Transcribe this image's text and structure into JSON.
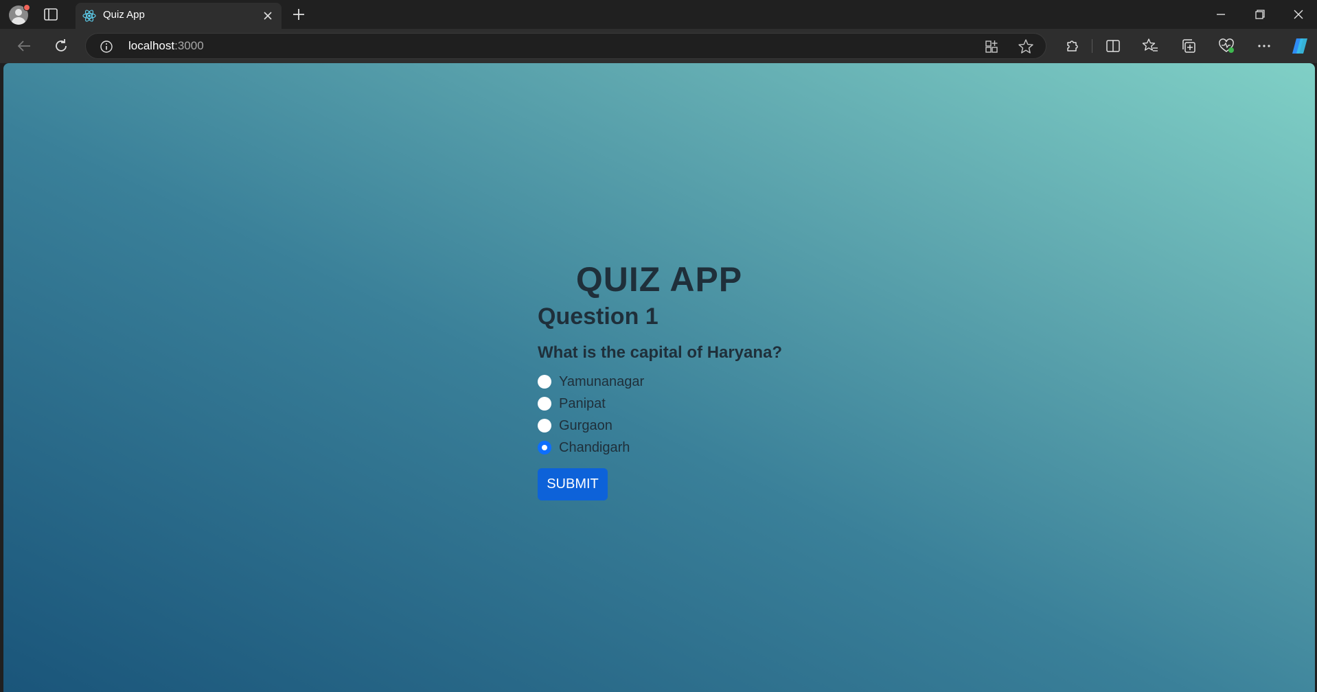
{
  "browser": {
    "tab_title": "Quiz App",
    "url_host": "localhost",
    "url_port": ":3000"
  },
  "icons": {
    "profile": "avatar-icon",
    "tab_favicon": "react-icon",
    "back": "arrow-left-icon",
    "reload": "refresh-icon",
    "info": "info-icon",
    "favorite": "star-icon",
    "copilot": "copilot-icon"
  },
  "quiz": {
    "app_title": "QUIZ APP",
    "question_number": "Question 1",
    "question_text": "What is the capital of Haryana?",
    "options": [
      "Yamunanagar",
      "Panipat",
      "Gurgaon",
      "Chandigarh"
    ],
    "selected_option": "Chandigarh",
    "submit_label": "SUBMIT"
  },
  "colors": {
    "accent": "#0d6efd",
    "submit_bg": "#0d62d9",
    "heading_text": "#1f2f3a",
    "gradient_bottom_left": "#1a557a",
    "gradient_top_right": "#80d0c6"
  }
}
